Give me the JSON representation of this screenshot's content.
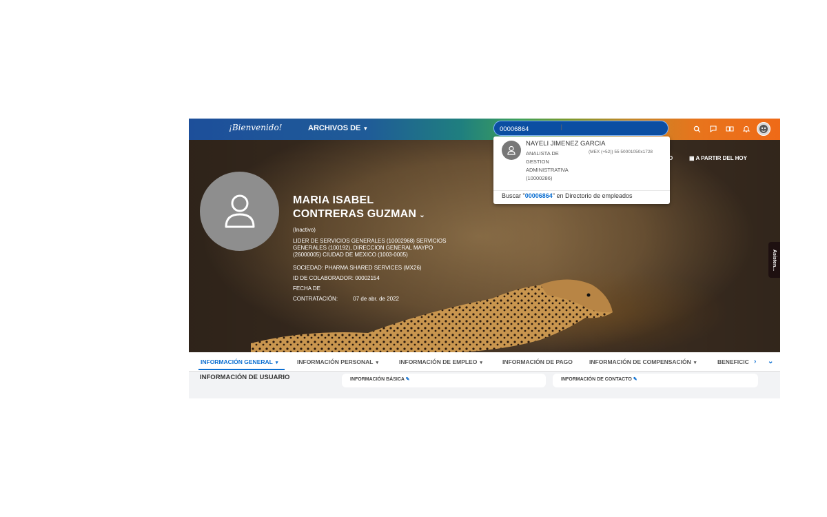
{
  "header": {
    "logo_text": "¡Bienvenido!",
    "archivos_label": "ARCHIVOS DE",
    "search_value": "00006864"
  },
  "dropdown": {
    "result_name": "NAYELI JIMENEZ GARCIA",
    "result_title": "ANALISTA DE GESTION ADMINISTRATIVA (10000286)",
    "result_phone": "(MEX (+52)) 55 50001050x1728",
    "search_prefix": "Buscar \"",
    "search_query": "00006864",
    "search_suffix": "\" en Directorio de empleados"
  },
  "profile": {
    "name_line1": "MARIA ISABEL",
    "name_line2": "CONTRERAS GUZMAN",
    "status": "(Inactivo)",
    "position": "LIDER DE SERVICIOS GENERALES (10002968) SERVICIOS GENERALES (100192), DIRECCION GENERAL MAYPO (26000005) CIUDAD DE MEXICO (1003-0005)",
    "email": "",
    "sociedad": "SOCIEDAD: PHARMA SHARED SERVICES (MX26)",
    "id_colaborador": "ID DE COLABORADOR: 00002154",
    "fecha_label_1": "FECHA DE",
    "fecha_label_2": "CONTRATACIÓN:",
    "fecha_value": "07 de abr. de 2022"
  },
  "hero_actions": {
    "partial_left": "O",
    "a_partir": "A PARTIR DEL HOY",
    "assistant_label": "Asisten..."
  },
  "tabs": [
    {
      "label": "INFORMACIÓN GENERAL"
    },
    {
      "label": "INFORMACIÓN PERSONAL"
    },
    {
      "label": "INFORMACIÓN DE EMPLEO"
    },
    {
      "label": "INFORMACIÓN DE PAGO"
    },
    {
      "label": "INFORMACIÓN DE COMPENSACIÓN"
    },
    {
      "label": "BENEFICIC"
    }
  ],
  "content": {
    "section_title": "INFORMACIÓN DE USUARIO",
    "card1_title": "INFORMACIÓN BÁSICA",
    "card2_title": "INFORMACIÓN DE CONTACTO"
  },
  "colors": {
    "accent": "#0a6ed1",
    "topbar_start": "#1d4f9a",
    "topbar_end": "#ef6a17"
  }
}
